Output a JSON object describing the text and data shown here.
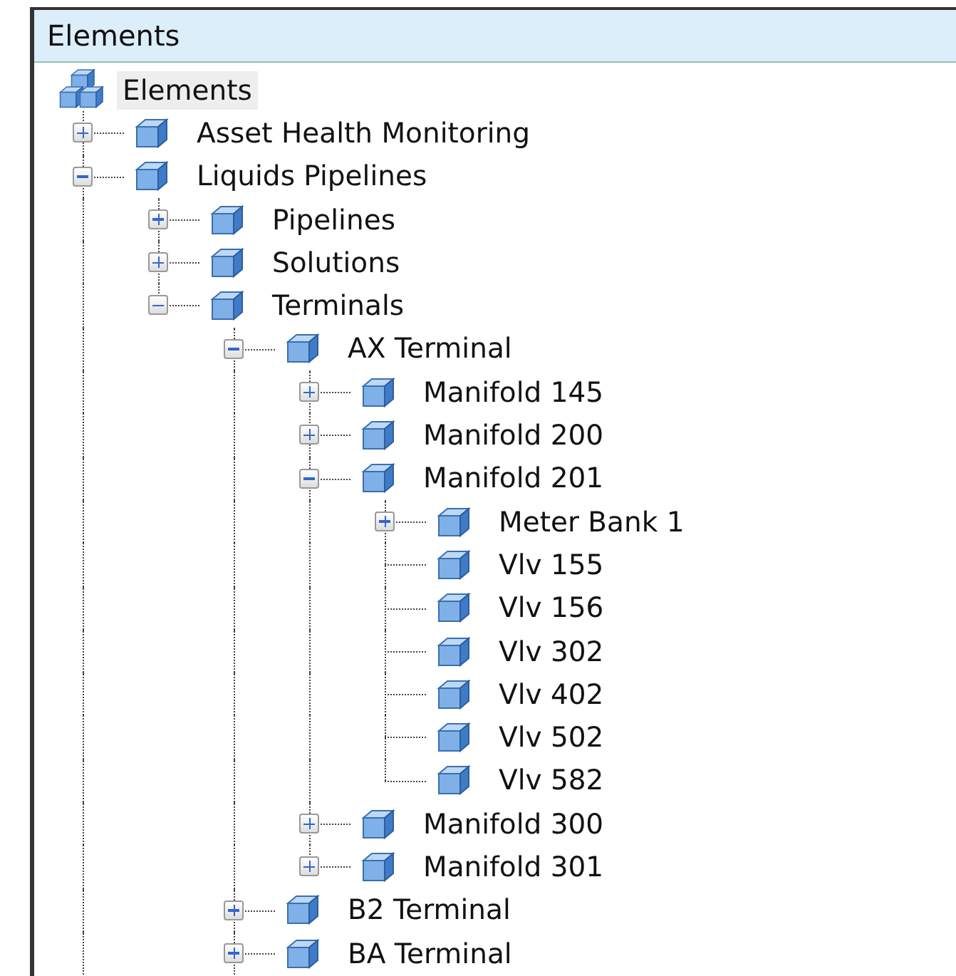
{
  "panel": {
    "title": "Elements"
  },
  "tree": {
    "label": "Elements",
    "selected": true,
    "children": [
      {
        "label": "Asset Health Monitoring",
        "selected": false,
        "expanded": false
      },
      {
        "label": "Liquids Pipelines",
        "selected": false,
        "expanded": true,
        "line_continues": true,
        "children": [
          {
            "label": "Pipelines",
            "selected": false,
            "expanded": false
          },
          {
            "label": "Solutions",
            "selected": false,
            "expanded": false
          },
          {
            "label": "Terminals",
            "selected": false,
            "expanded": true,
            "children": [
              {
                "label": "AX Terminal",
                "selected": false,
                "expanded": true,
                "children": [
                  {
                    "label": "Manifold 145",
                    "selected": false,
                    "expanded": false
                  },
                  {
                    "label": "Manifold 200",
                    "selected": false,
                    "expanded": false
                  },
                  {
                    "label": "Manifold 201",
                    "selected": false,
                    "expanded": true,
                    "children": [
                      {
                        "label": "Meter Bank 1",
                        "selected": false,
                        "expanded": false
                      },
                      {
                        "label": "Vlv 155",
                        "selected": false
                      },
                      {
                        "label": "Vlv 156",
                        "selected": false
                      },
                      {
                        "label": "Vlv 302",
                        "selected": false
                      },
                      {
                        "label": "Vlv 402",
                        "selected": false
                      },
                      {
                        "label": "Vlv 502",
                        "selected": false
                      },
                      {
                        "label": "Vlv 582",
                        "selected": false
                      }
                    ]
                  },
                  {
                    "label": "Manifold 300",
                    "selected": false,
                    "expanded": false
                  },
                  {
                    "label": "Manifold 301",
                    "selected": false,
                    "expanded": false
                  }
                ]
              },
              {
                "label": "B2 Terminal",
                "selected": false,
                "expanded": false
              },
              {
                "label": "BA Terminal",
                "selected": false,
                "expanded": false,
                "line_continues": true
              }
            ]
          }
        ]
      }
    ]
  }
}
